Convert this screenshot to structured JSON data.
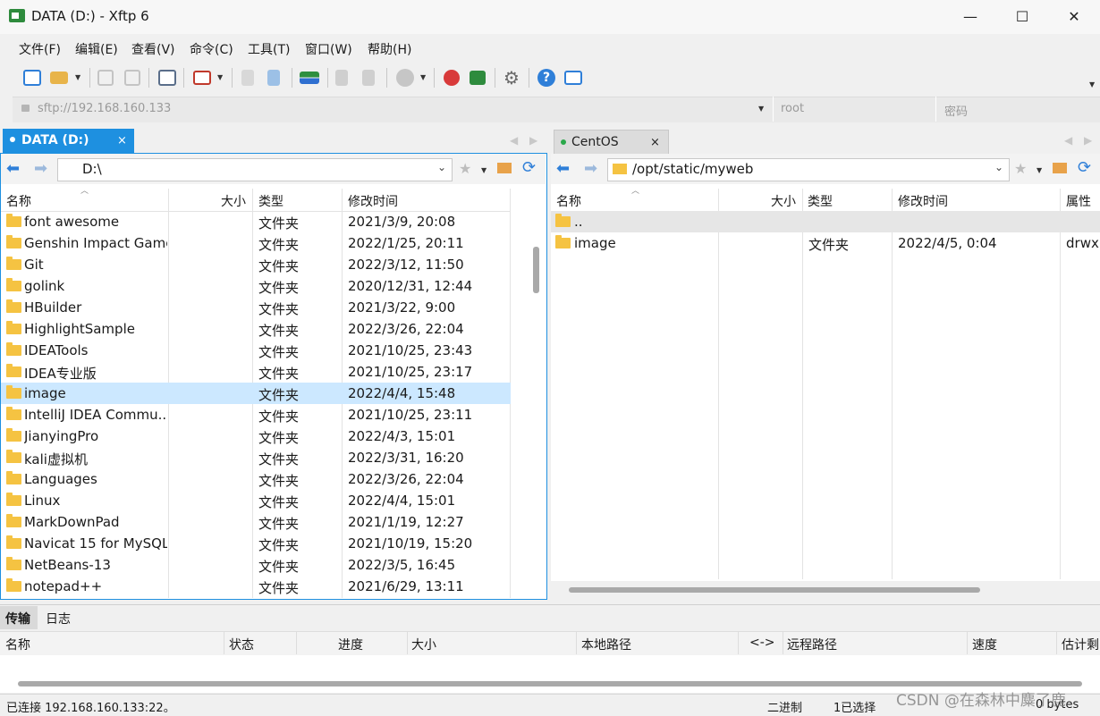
{
  "window": {
    "title": "DATA (D:) - Xftp 6",
    "min": "—",
    "max": "☐",
    "close": "✕"
  },
  "menu": [
    "文件(F)",
    "编辑(E)",
    "查看(V)",
    "命令(C)",
    "工具(T)",
    "窗口(W)",
    "帮助(H)"
  ],
  "address": {
    "url": "sftp://192.168.160.133",
    "user": "root",
    "password": "密码"
  },
  "local": {
    "tab": "DATA (D:)",
    "tab_close": "×",
    "path": "D:\\",
    "columns": [
      "名称",
      "大小",
      "类型",
      "修改时间"
    ],
    "rows": [
      {
        "name": "font awesome",
        "type": "文件夹",
        "modified": "2021/3/9, 20:08"
      },
      {
        "name": "Genshin Impact Game",
        "type": "文件夹",
        "modified": "2022/1/25, 20:11"
      },
      {
        "name": "Git",
        "type": "文件夹",
        "modified": "2022/3/12, 11:50"
      },
      {
        "name": "golink",
        "type": "文件夹",
        "modified": "2020/12/31, 12:44"
      },
      {
        "name": "HBuilder",
        "type": "文件夹",
        "modified": "2021/3/22, 9:00"
      },
      {
        "name": "HighlightSample",
        "type": "文件夹",
        "modified": "2022/3/26, 22:04"
      },
      {
        "name": "IDEATools",
        "type": "文件夹",
        "modified": "2021/10/25, 23:43"
      },
      {
        "name": "IDEA专业版",
        "type": "文件夹",
        "modified": "2021/10/25, 23:17"
      },
      {
        "name": "image",
        "type": "文件夹",
        "modified": "2022/4/4, 15:48"
      },
      {
        "name": "IntelliJ IDEA Commu...",
        "type": "文件夹",
        "modified": "2021/10/25, 23:11"
      },
      {
        "name": "JianyingPro",
        "type": "文件夹",
        "modified": "2022/4/3, 15:01"
      },
      {
        "name": "kali虚拟机",
        "type": "文件夹",
        "modified": "2022/3/31, 16:20"
      },
      {
        "name": "Languages",
        "type": "文件夹",
        "modified": "2022/3/26, 22:04"
      },
      {
        "name": "Linux",
        "type": "文件夹",
        "modified": "2022/4/4, 15:01"
      },
      {
        "name": "MarkDownPad",
        "type": "文件夹",
        "modified": "2021/1/19, 12:27"
      },
      {
        "name": "Navicat 15 for MySQL",
        "type": "文件夹",
        "modified": "2021/10/19, 15:20"
      },
      {
        "name": "NetBeans-13",
        "type": "文件夹",
        "modified": "2022/3/5, 16:45"
      },
      {
        "name": "notepad++",
        "type": "文件夹",
        "modified": "2021/6/29, 13:11"
      }
    ]
  },
  "remote": {
    "tab": "CentOS",
    "tab_close": "×",
    "path": "/opt/static/myweb",
    "columns": [
      "名称",
      "大小",
      "类型",
      "修改时间",
      "属性"
    ],
    "rows": [
      {
        "name": "..",
        "type": "",
        "modified": "",
        "attr": ""
      },
      {
        "name": "image",
        "type": "文件夹",
        "modified": "2022/4/5, 0:04",
        "attr": "drwxr"
      }
    ]
  },
  "transfer": {
    "tabs": [
      "传输",
      "日志"
    ],
    "columns": [
      "名称",
      "状态",
      "进度",
      "大小",
      "本地路径",
      "<->",
      "远程路径",
      "速度",
      "估计剩"
    ]
  },
  "status": {
    "connection": "已连接 192.168.160.133:22。",
    "mode": "二进制",
    "selection": "1已选择",
    "size": "0 bytes"
  },
  "watermark": "CSDN @在森林中麋了鹿",
  "colors": {
    "accent": "#1e90e0",
    "selected_row": "#cce8ff",
    "folder": "#f5c342"
  }
}
